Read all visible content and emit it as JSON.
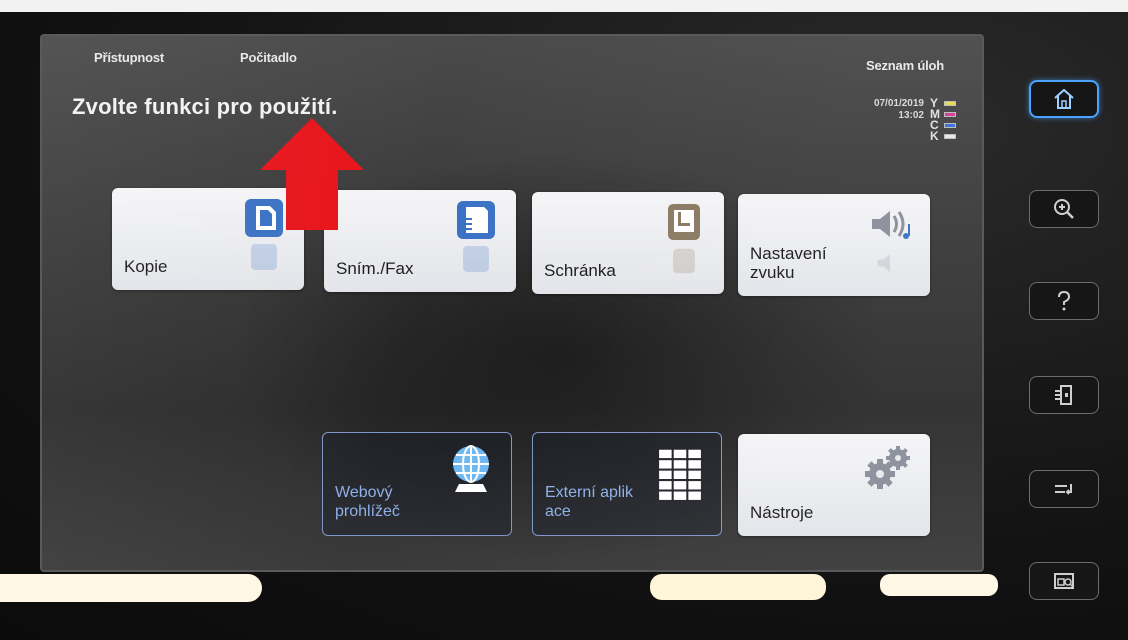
{
  "header": {
    "accessibility_label": "Přístupnost",
    "counter_label": "Počitadlo",
    "job_list_label": "Seznam úloh",
    "prompt": "Zvolte funkci pro použití.",
    "date": "07/01/2019",
    "time": "13:02"
  },
  "toner": [
    {
      "letter": "Y",
      "color": "#e8d84a"
    },
    {
      "letter": "M",
      "color": "#d43a9a"
    },
    {
      "letter": "C",
      "color": "#3a6ed8"
    },
    {
      "letter": "K",
      "color": "#e8e8e8"
    }
  ],
  "functions": {
    "copy": {
      "label": "Kopie",
      "icon": "copy-icon"
    },
    "scan_fax": {
      "label": "Sním./Fax",
      "icon": "scan-fax-icon"
    },
    "box": {
      "label": "Schránka",
      "icon": "box-icon"
    },
    "sound": {
      "label_line1": "Nastavení",
      "label_line2": "zvuku",
      "icon": "speaker-icon"
    },
    "web_browser": {
      "label_line1": "Webový",
      "label_line2": "prohlížeč",
      "icon": "globe-icon"
    },
    "external_apps": {
      "label_line1": "Externí aplik",
      "label_line2": "ace",
      "icon": "app-grid-icon"
    },
    "tools": {
      "label": "Nástroje",
      "icon": "gear-icon"
    }
  },
  "hardware_keys": [
    "home-icon",
    "zoom-in-icon",
    "help-icon",
    "access-icon",
    "power-save-icon",
    "register-key-icon"
  ],
  "colors": {
    "tile_icon_blue": "#3b72c4",
    "dark_tile_border": "#7f96c8",
    "dark_tile_text": "#8fb0e8",
    "arrow_red": "#e8141b",
    "home_key_glow": "#4aa3ff"
  }
}
